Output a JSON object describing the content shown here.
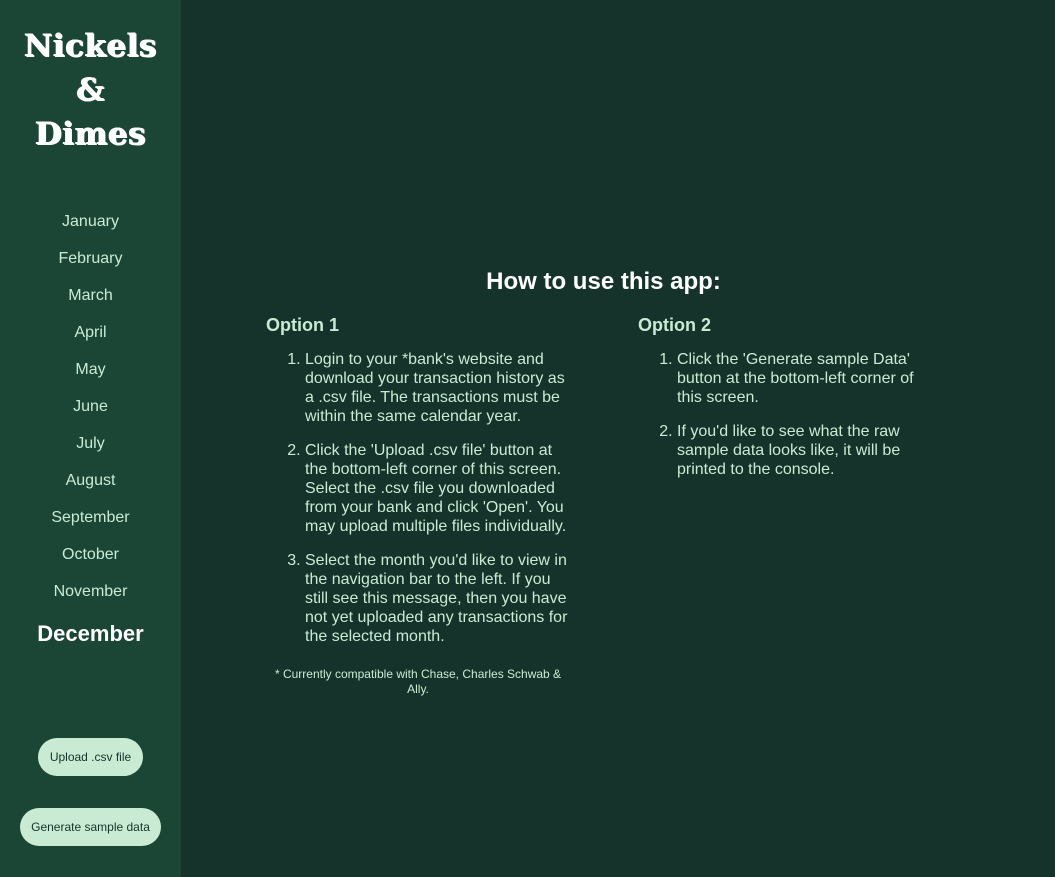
{
  "app": {
    "logo_lines": [
      "Nickels",
      "&",
      "Dimes"
    ]
  },
  "sidebar": {
    "months": [
      "January",
      "February",
      "March",
      "April",
      "May",
      "June",
      "July",
      "August",
      "September",
      "October",
      "November",
      "December"
    ],
    "active_month": "December",
    "upload_label": "Upload .csv file",
    "generate_label": "Generate sample data"
  },
  "main": {
    "title": "How to use this app:",
    "option1": {
      "heading": "Option 1",
      "steps": [
        "Login to your *bank's website and download your transaction history as a .csv file. The transactions must be within the same calendar year.",
        "Click the 'Upload .csv file' button at the bottom-left corner of this screen. Select the .csv file you downloaded from your bank and click 'Open'. You may upload multiple files individually.",
        "Select the month you'd like to view in the navigation bar to the left. If you still see this message, then you have not yet uploaded any transactions for the selected month."
      ],
      "note": "* Currently compatible with Chase, Charles Schwab & Ally."
    },
    "option2": {
      "heading": "Option 2",
      "steps": [
        "Click the 'Generate sample Data' button at the bottom-left corner of this screen.",
        "If you'd like to see what the raw sample data looks like, it will be printed to the console."
      ]
    }
  },
  "colors": {
    "background": "#15332a",
    "sidebar": "#1b4535",
    "accent": "#c9ebd4",
    "text_strong": "#ffffff"
  }
}
